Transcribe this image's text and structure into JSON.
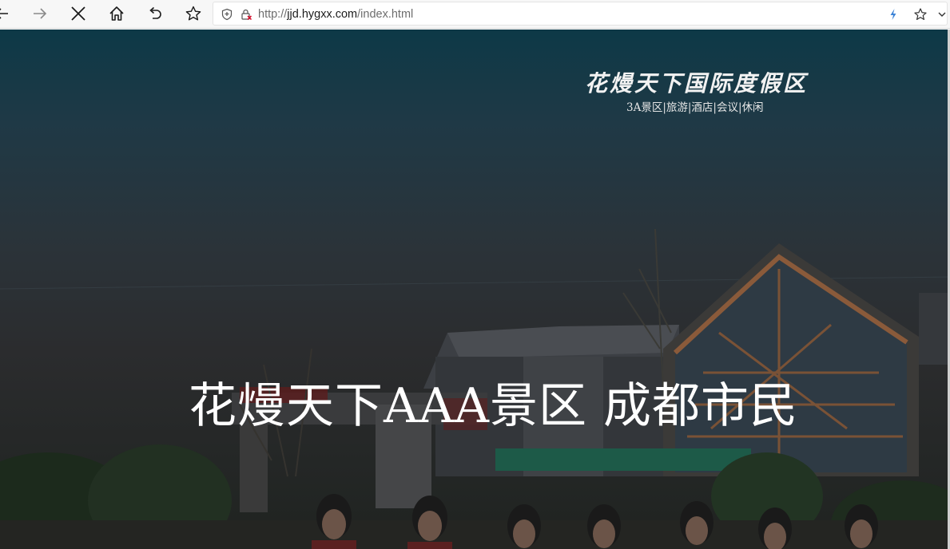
{
  "browser": {
    "url_scheme": "http://",
    "url_host": "jjd.hygxx.com",
    "url_path": "/index.html"
  },
  "page": {
    "logo_title": "花熳天下国际度假区",
    "logo_subtitle": "3A景区|旅游|酒店|会议|休闲",
    "banner_text": "花熳天下AAA景区 成都市民"
  },
  "colors": {
    "toolbar_bg": "#f7f7f7",
    "hero_top": "#0d3947",
    "hero_bottom": "#1f2320",
    "lightning": "#3b82d6"
  }
}
